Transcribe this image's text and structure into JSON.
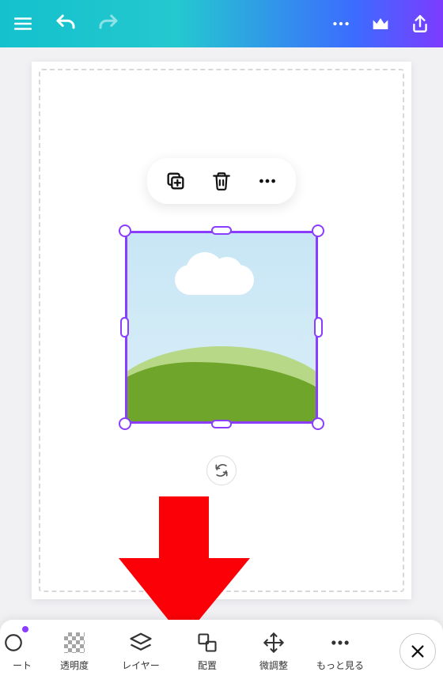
{
  "topbar": {
    "menu_icon": "menu-icon",
    "undo_icon": "undo-icon",
    "redo_icon": "redo-icon",
    "more_icon": "more-icon",
    "crown_icon": "crown-icon",
    "share_icon": "share-icon"
  },
  "context_toolbar": {
    "duplicate_icon": "duplicate-icon",
    "delete_icon": "trash-icon",
    "more_icon": "more-icon"
  },
  "rotate_icon": "rotate-icon",
  "bottom_tools": {
    "item0": {
      "label": "ート"
    },
    "item1": {
      "label": "透明度"
    },
    "item2": {
      "label": "レイヤー"
    },
    "item3": {
      "label": "配置"
    },
    "item4": {
      "label": "微調整"
    },
    "item5": {
      "label": "もっと見る"
    }
  },
  "close_icon": "close-icon",
  "colors": {
    "selection": "#8b3dff",
    "annotation_arrow": "#fb0007"
  }
}
